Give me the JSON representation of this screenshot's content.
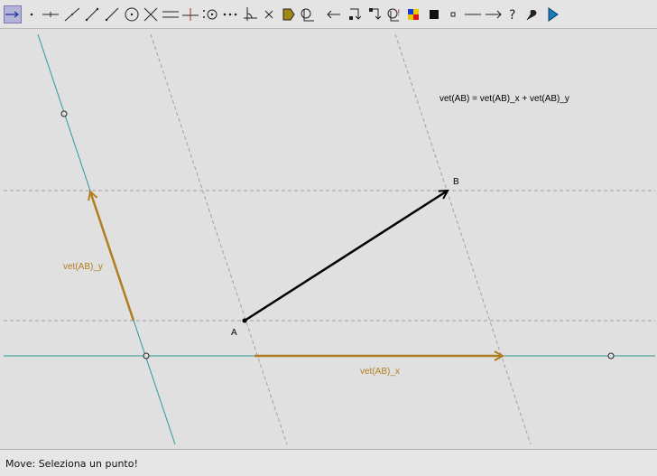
{
  "toolbar": {
    "tools": [
      {
        "id": "move",
        "icon": "move-arrow-icon",
        "active": true
      },
      {
        "id": "point",
        "icon": "point-icon"
      },
      {
        "id": "point-on-object",
        "icon": "point-on-line-icon"
      },
      {
        "id": "line",
        "icon": "line-icon"
      },
      {
        "id": "segment",
        "icon": "segment-icon"
      },
      {
        "id": "ray",
        "icon": "ray-icon"
      },
      {
        "id": "circle",
        "icon": "circle-icon"
      },
      {
        "id": "intersect",
        "icon": "intersect-icon"
      },
      {
        "id": "parallel",
        "icon": "parallel-icon"
      },
      {
        "id": "perpendicular",
        "icon": "perpendicular-icon"
      },
      {
        "id": "midpoint",
        "icon": "midpoint-icon"
      },
      {
        "id": "dotted",
        "icon": "dotted-line-icon"
      },
      {
        "id": "angle",
        "icon": "angle-icon"
      },
      {
        "id": "delete",
        "icon": "delete-cross-icon"
      },
      {
        "id": "fill",
        "icon": "fill-icon"
      },
      {
        "id": "locus",
        "icon": "locus-icon"
      },
      {
        "id": "undo",
        "icon": "back-arrow-icon"
      },
      {
        "id": "macro-1",
        "icon": "macro-icon"
      },
      {
        "id": "macro-2",
        "icon": "macro-reverse-icon"
      },
      {
        "id": "query",
        "icon": "query-icon"
      },
      {
        "id": "color",
        "icon": "color-palette-icon"
      },
      {
        "id": "black-square",
        "icon": "filled-square-icon"
      },
      {
        "id": "small-square",
        "icon": "small-square-icon"
      },
      {
        "id": "thin-line",
        "icon": "thin-line-icon"
      },
      {
        "id": "arrow",
        "icon": "arrow-right-icon"
      },
      {
        "id": "help",
        "icon": "question-mark-icon"
      },
      {
        "id": "pin",
        "icon": "pin-icon"
      },
      {
        "id": "play",
        "icon": "play-icon"
      }
    ]
  },
  "canvas": {
    "formula": "vet(AB) = vet(AB)_x + vet(AB)_y",
    "point_a_label": "A",
    "point_b_label": "B",
    "vector_x_label": "vet(AB)_x",
    "vector_y_label": "vet(AB)_y",
    "colors": {
      "axis": "#2a9a9a",
      "component": "#b07d1e",
      "vector": "#000000",
      "dashed": "#a0a0a0"
    }
  },
  "status": {
    "message": "Move: Seleziona un punto!"
  }
}
